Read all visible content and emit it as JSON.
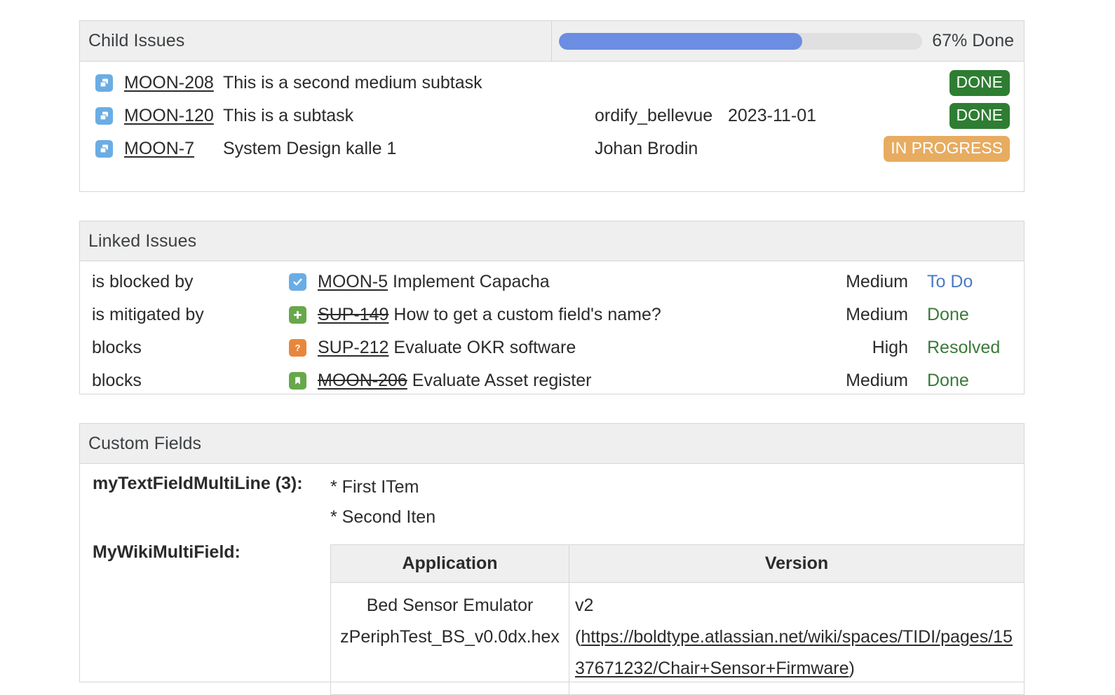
{
  "child_issues": {
    "title": "Child Issues",
    "progress": {
      "percent": 67,
      "label": "67% Done",
      "bar_color": "#6b8ee2",
      "track_color": "#e0e0e0"
    },
    "rows": [
      {
        "icon": "subtask-icon",
        "key": "MOON-208",
        "summary": "This is a second medium subtask",
        "assignee": "",
        "date": "",
        "status": "DONE",
        "status_color": "#2e7d32"
      },
      {
        "icon": "subtask-icon",
        "key": "MOON-120",
        "summary": "This is a subtask",
        "assignee": "ordify_bellevue",
        "date": "2023-11-01",
        "status": "DONE",
        "status_color": "#2e7d32"
      },
      {
        "icon": "subtask-icon",
        "key": "MOON-7",
        "summary": "System Design kalle 1",
        "assignee": "Johan Brodin",
        "date": "",
        "status": "IN PROGRESS",
        "status_color": "#e7ac60"
      }
    ]
  },
  "linked_issues": {
    "title": "Linked Issues",
    "rows": [
      {
        "link_type": "is blocked by",
        "icon": "task-check-icon",
        "key": "MOON-5",
        "summary": "Implement Capacha",
        "resolved": false,
        "priority": "Medium",
        "status": "To Do",
        "status_color": "#4a79c7"
      },
      {
        "link_type": "is mitigated by",
        "icon": "improvement-plus-icon",
        "key": "SUP-149",
        "summary": "How to get a custom field's name?",
        "resolved": true,
        "priority": "Medium",
        "status": "Done",
        "status_color": "#3a7a3a"
      },
      {
        "link_type": "blocks",
        "icon": "question-mark-icon",
        "key": "SUP-212",
        "summary": "Evaluate OKR software",
        "resolved": false,
        "priority": "High",
        "status": "Resolved",
        "status_color": "#3a7a3a"
      },
      {
        "link_type": "blocks",
        "icon": "story-bookmark-icon",
        "key": "MOON-206",
        "summary": "Evaluate Asset register",
        "resolved": true,
        "priority": "Medium",
        "status": "Done",
        "status_color": "#3a7a3a"
      }
    ]
  },
  "custom_fields": {
    "title": "Custom Fields",
    "text_field": {
      "label": "myTextFieldMultiLine (3):",
      "lines": [
        "* First ITem",
        "* Second Iten"
      ]
    },
    "wiki_field": {
      "label": "MyWikiMultiField:",
      "columns": [
        "Application",
        "Version"
      ],
      "rows": [
        {
          "application_line1": "Bed Sensor Emulator",
          "application_line2": "zPeriphTest_BS_v0.0dx.hex",
          "version_prefix": "v2",
          "version_open_paren": "(",
          "version_url": "https://boldtype.atlassian.net/wiki/spaces/TIDI/pages/1537671232/Chair+Sensor+Firmware",
          "version_close_paren": ")"
        }
      ]
    }
  }
}
